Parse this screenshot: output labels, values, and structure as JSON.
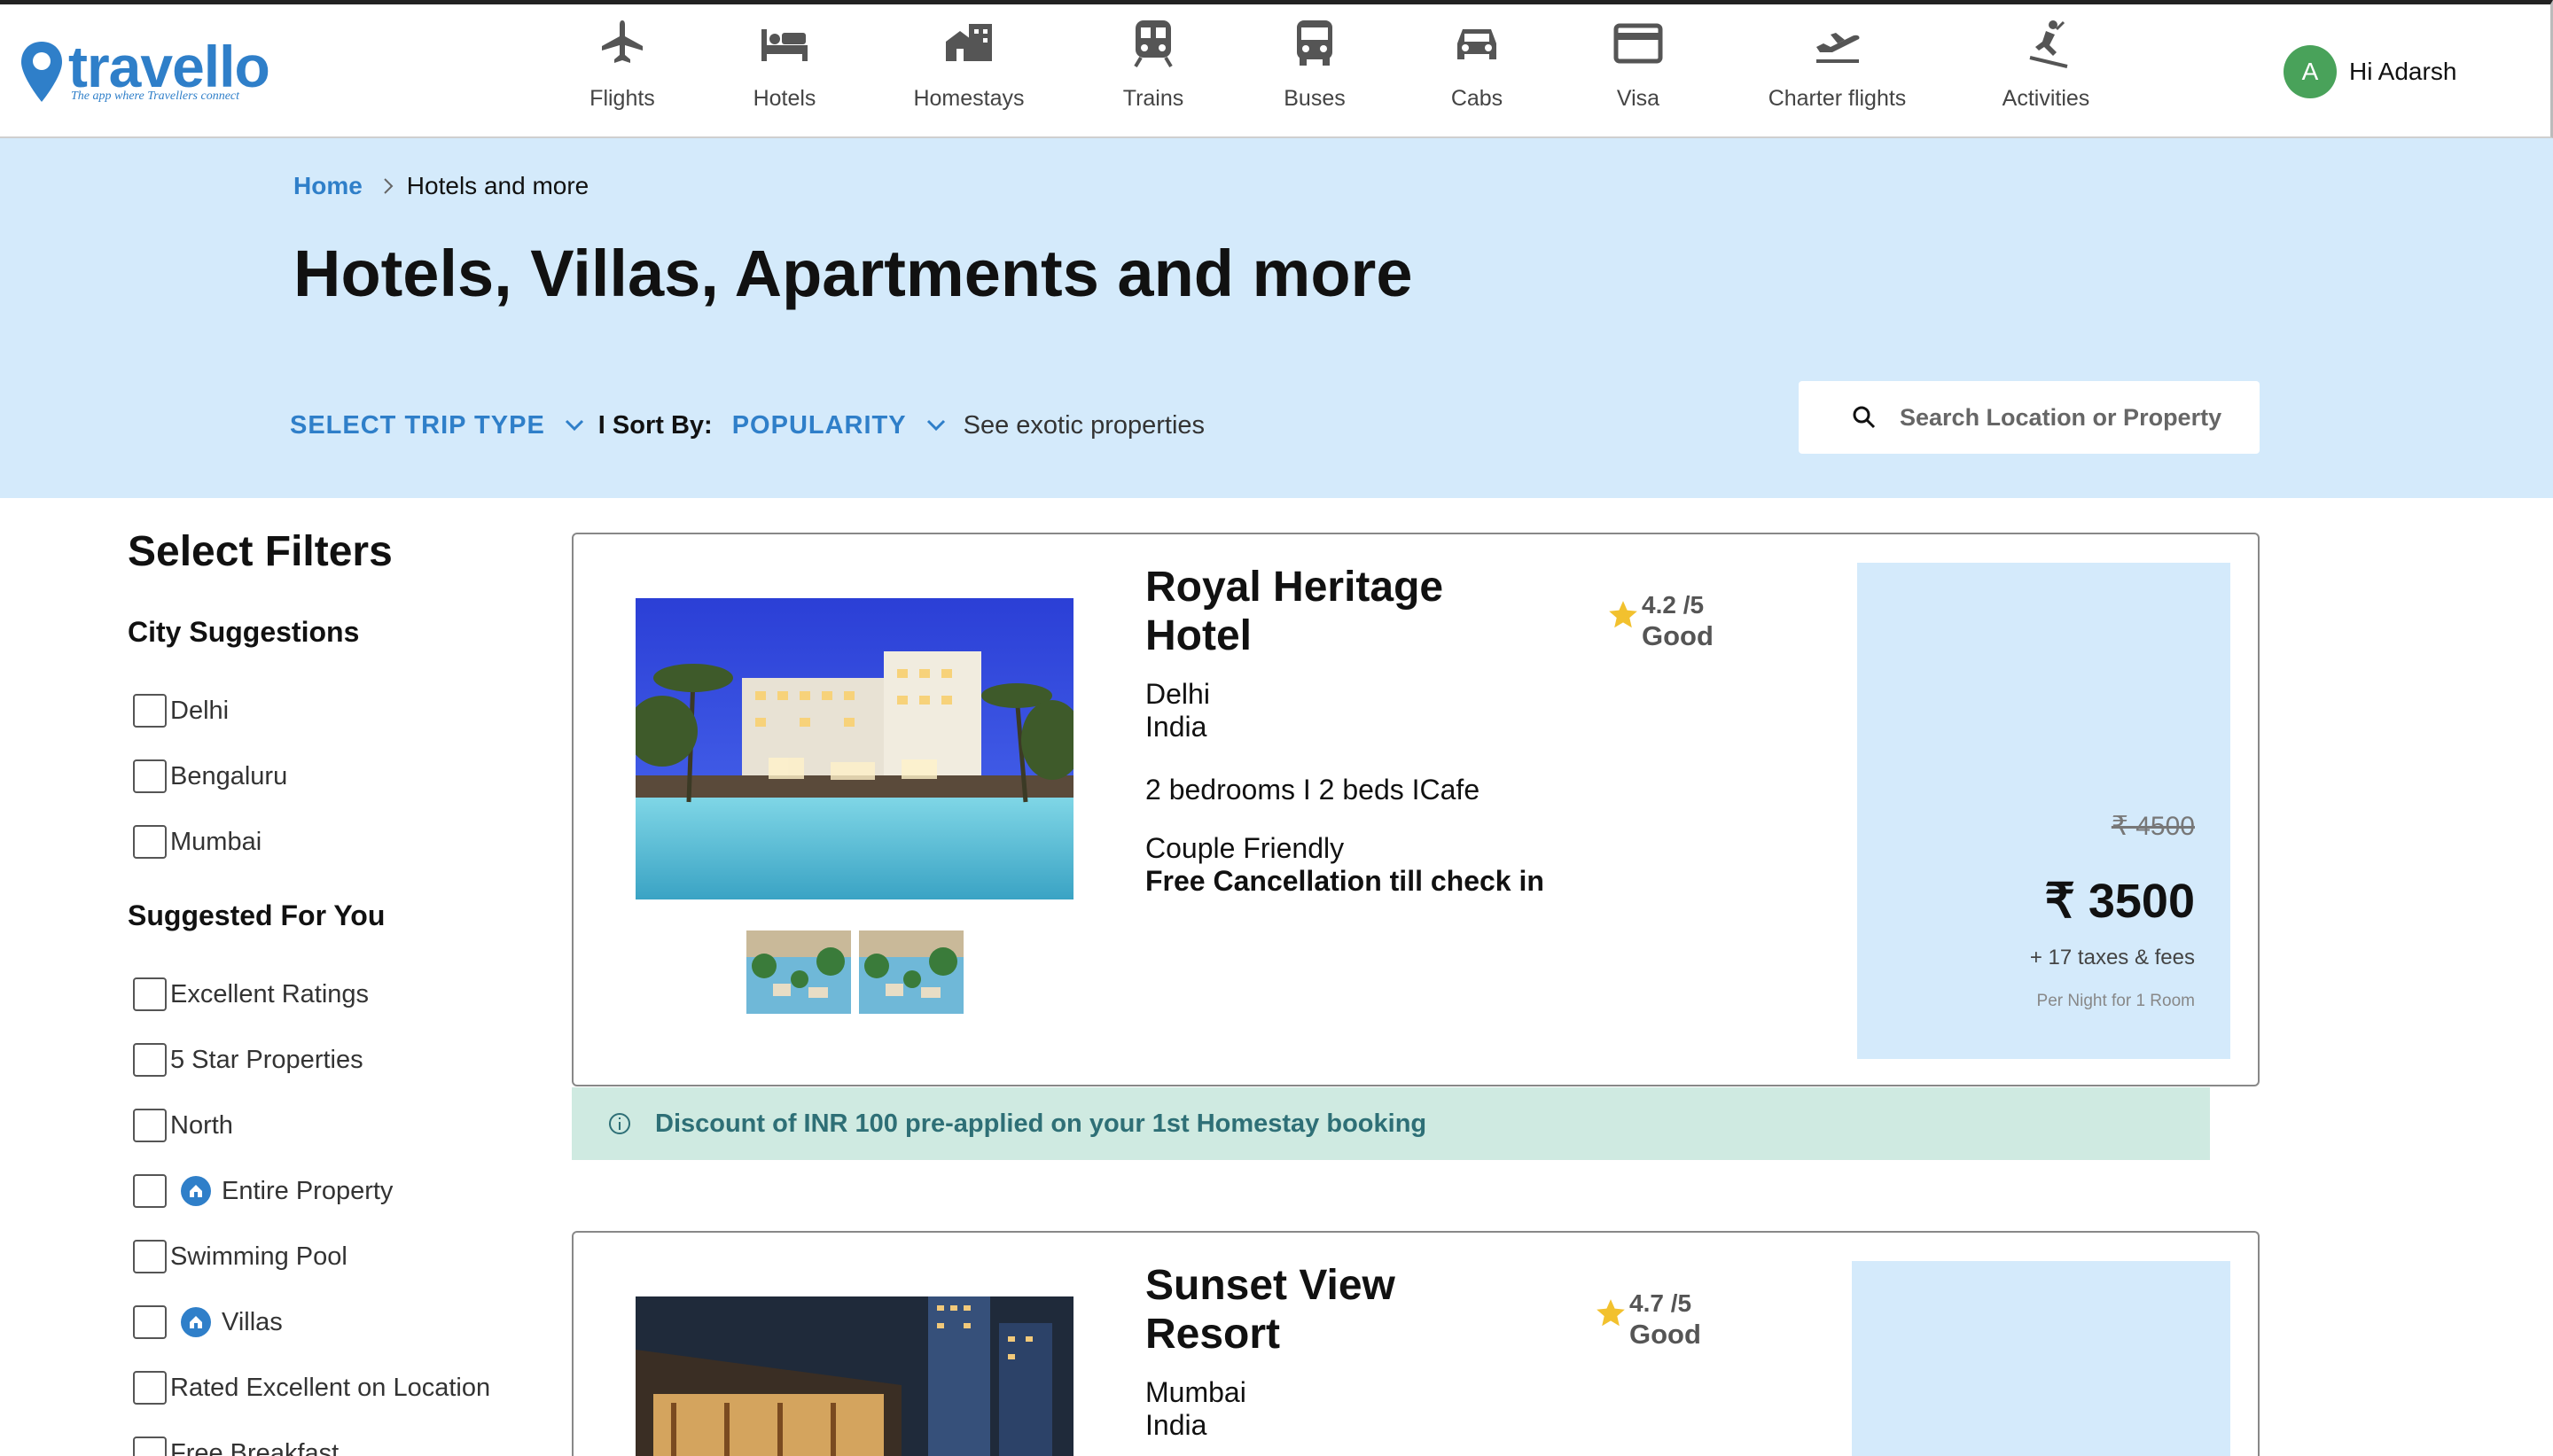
{
  "brand": {
    "name": "travello",
    "tagline": "The app where Travellers connect"
  },
  "nav": {
    "items": [
      {
        "label": "Flights",
        "icon": "plane-icon"
      },
      {
        "label": "Hotels",
        "icon": "bed-icon"
      },
      {
        "label": "Homestays",
        "icon": "homestay-icon"
      },
      {
        "label": "Trains",
        "icon": "train-icon"
      },
      {
        "label": "Buses",
        "icon": "bus-icon"
      },
      {
        "label": "Cabs",
        "icon": "car-icon"
      },
      {
        "label": "Visa",
        "icon": "card-icon"
      },
      {
        "label": "Charter flights",
        "icon": "takeoff-icon"
      },
      {
        "label": "Activities",
        "icon": "skier-icon"
      }
    ]
  },
  "user": {
    "initial": "A",
    "greeting": "Hi Adarsh"
  },
  "breadcrumb": {
    "home": "Home",
    "current": "Hotels and more"
  },
  "page_title": "Hotels, Villas, Apartments and more",
  "controls": {
    "trip_type": "SELECT TRIP TYPE",
    "sort_label": "I Sort By:",
    "sort_value": "POPULARITY",
    "exotic": "See exotic properties"
  },
  "search": {
    "placeholder": "Search Location or Property"
  },
  "filters": {
    "title": "Select Filters",
    "city_heading": "City Suggestions",
    "cities": [
      "Delhi",
      "Bengaluru",
      "Mumbai"
    ],
    "suggested_heading": "Suggested For You",
    "suggested": [
      {
        "label": "Excellent Ratings",
        "home_icon": false
      },
      {
        "label": "5 Star Properties",
        "home_icon": false
      },
      {
        "label": "North",
        "home_icon": false
      },
      {
        "label": "Entire Property",
        "home_icon": true
      },
      {
        "label": "Swimming Pool",
        "home_icon": false
      },
      {
        "label": "Villas",
        "home_icon": true
      },
      {
        "label": "Rated Excellent on Location",
        "home_icon": false
      },
      {
        "label": "Free Breakfast",
        "home_icon": false
      }
    ]
  },
  "hotels": [
    {
      "name": "Royal Heritage Hotel",
      "rating": "4.2 /5",
      "rating_text": "Good",
      "city": "Delhi",
      "country": "India",
      "rooms": "2 bedrooms I 2 beds ICafe",
      "tag": "Couple Friendly",
      "cancellation": "Free Cancellation till check in",
      "old_price": "₹ 4500",
      "price": "₹ 3500",
      "taxes": "+ 17 taxes & fees",
      "per_night": "Per Night for 1 Room"
    },
    {
      "name": "Sunset View Resort",
      "rating": "4.7 /5",
      "rating_text": "Good",
      "city": "Mumbai",
      "country": "India"
    }
  ],
  "discount": {
    "text": "Discount of INR 100 pre-applied on your 1st Homestay booking"
  },
  "colors": {
    "accent": "#2f7fc9",
    "hero_bg": "#d4eafb",
    "discount_bg": "#cfeae1",
    "star": "#f2c12e"
  }
}
